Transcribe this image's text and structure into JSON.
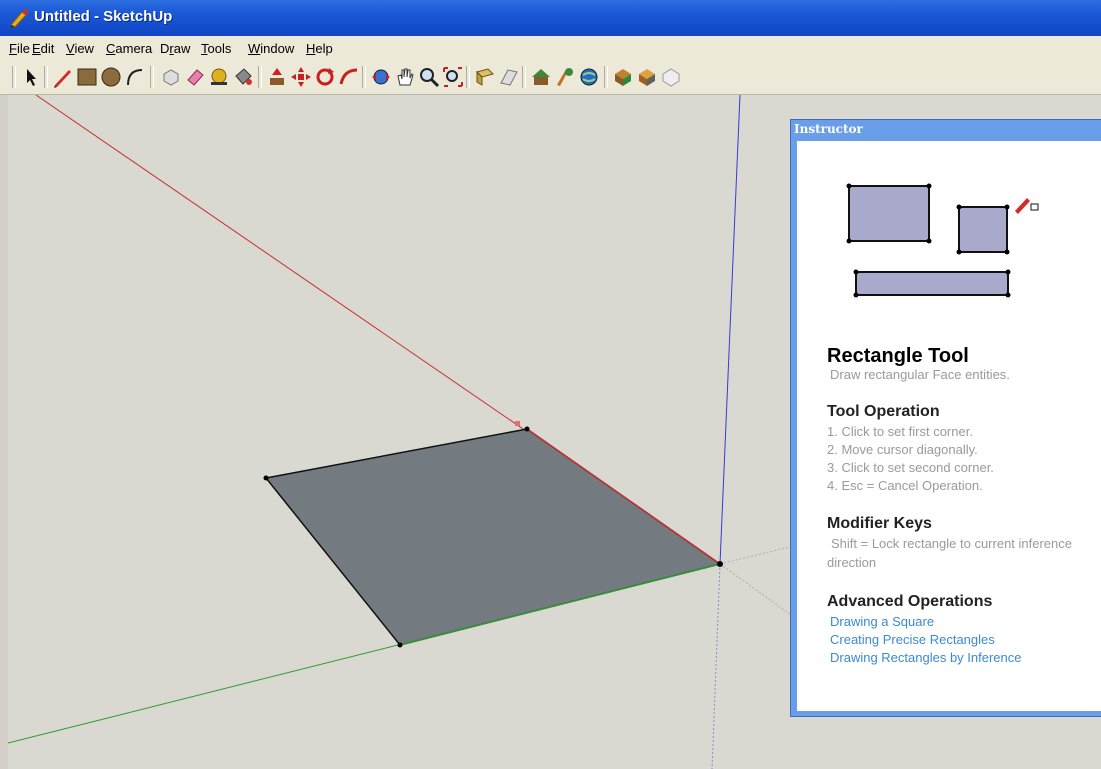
{
  "window": {
    "title": "Untitled - SketchUp"
  },
  "menu": [
    "File",
    "Edit",
    "View",
    "Camera",
    "Draw",
    "Tools",
    "Window",
    "Help"
  ],
  "menu_underline": [
    "F",
    "E",
    "V",
    "C",
    "r",
    "T",
    "W",
    "H"
  ],
  "instructor": {
    "panel_title": "Instructor",
    "tool_title": "Rectangle Tool",
    "tool_desc": "Draw rectangular Face entities.",
    "operation_heading": "Tool Operation",
    "steps": [
      "1.   Click to set first corner.",
      "2.   Move cursor diagonally.",
      "3.   Click to set second corner.",
      "4.   Esc = Cancel Operation."
    ],
    "modifier_heading": "Modifier Keys",
    "modifier_text_1": "Shift = Lock rectangle to current inference",
    "modifier_text_2": "direction",
    "advanced_heading": "Advanced Operations",
    "links": [
      "Drawing a Square",
      "Creating Precise Rectangles",
      "Drawing Rectangles by Inference"
    ]
  },
  "colors": {
    "titlebar": "#1a56d6",
    "face": "#747b80",
    "red_axis": "#c83030",
    "green_axis": "#2e9a2e",
    "blue_axis": "#3a3ad0",
    "link": "#3a8ad3"
  }
}
